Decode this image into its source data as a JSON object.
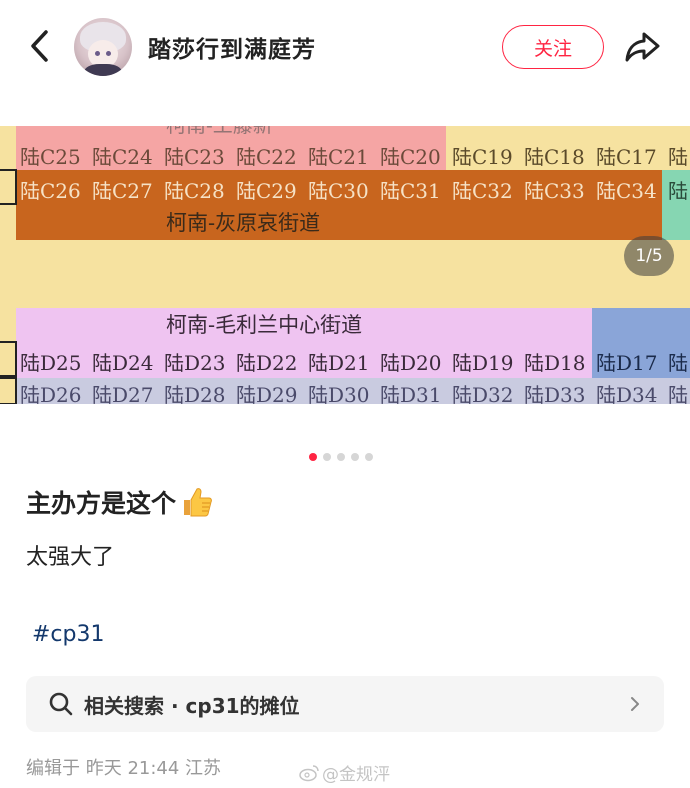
{
  "header": {
    "username": "踏莎行到满庭芳",
    "follow_label": "关注"
  },
  "media": {
    "counter": "1/5",
    "rows": [
      {
        "cells": [
          "陆C25",
          "陆C24",
          "陆C23",
          "陆C22",
          "陆C21",
          "陆C20",
          "陆C19",
          "陆C18",
          "陆C17",
          "陆"
        ]
      },
      {
        "cells": [
          "陆C26",
          "陆C27",
          "陆C28",
          "陆C29",
          "陆C30",
          "陆C31",
          "陆C32",
          "陆C33",
          "陆C34",
          "陆"
        ]
      },
      {
        "cells": [
          "陆D25",
          "陆D24",
          "陆D23",
          "陆D22",
          "陆D21",
          "陆D20",
          "陆D19",
          "陆D18",
          "陆D17",
          "陆"
        ]
      },
      {
        "cells": [
          "陆D26",
          "陆D27",
          "陆D28",
          "陆D29",
          "陆D30",
          "陆D31",
          "陆D32",
          "陆D33",
          "陆D34",
          "陆"
        ]
      }
    ],
    "street_c": "柯南-灰原哀街道",
    "street_d": "柯南-毛利兰中心街道",
    "partial_top": "柯南-工藤新一"
  },
  "pagination": {
    "total": 5,
    "active": 0
  },
  "post": {
    "title": "主办方是这个",
    "emoji": "thumbs-up-icon",
    "body": "太强大了",
    "tag": "#cp31"
  },
  "search": {
    "label": "相关搜索 · cp31的摊位"
  },
  "footer": {
    "meta": "编辑于 昨天 21:44 江苏",
    "watermark": "@金规泙"
  },
  "colors": {
    "accent": "#ff2442",
    "tag": "#13386c",
    "pink_block": "#f5a5a4",
    "orange_block": "#c8651e",
    "purple_block": "#efc4f1",
    "blue_block": "#8aa5d8",
    "yellow_bg": "#f6e2a0",
    "green_block": "#86d6b2"
  }
}
